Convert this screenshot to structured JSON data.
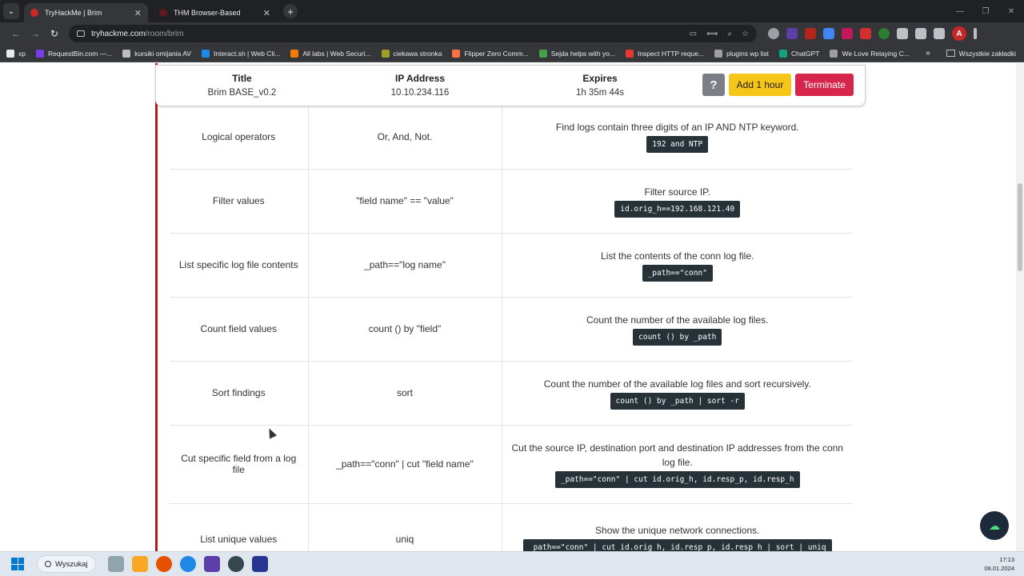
{
  "browser": {
    "tabs": [
      {
        "label": "TryHackMe | Brim",
        "active": true
      },
      {
        "label": "THM Browser-Based",
        "active": false
      }
    ],
    "url_host": "tryhackme.com",
    "url_path": "/room/brim",
    "profile_initial": "A"
  },
  "bookmarks": [
    {
      "label": "xp",
      "color": "#e8eaed"
    },
    {
      "label": "RequestBin.com —...",
      "color": "#7c3aed"
    },
    {
      "label": "kursiki omijania AV",
      "color": "#bdbdbd"
    },
    {
      "label": "Interact.sh | Web Cli...",
      "color": "#1e88e5"
    },
    {
      "label": "All labs | Web Securi...",
      "color": "#f57c00"
    },
    {
      "label": "ciekawa stronka",
      "color": "#9e9d24"
    },
    {
      "label": "Flipper Zero Comm...",
      "color": "#ff7043"
    },
    {
      "label": "Sejda helps with yo...",
      "color": "#43a047"
    },
    {
      "label": "Inspect HTTP reque...",
      "color": "#e53935"
    },
    {
      "label": "plugins wp list",
      "color": "#9e9e9e"
    },
    {
      "label": "ChatGPT",
      "color": "#10a37f"
    },
    {
      "label": "We Love Relaying C...",
      "color": "#9e9e9e"
    }
  ],
  "bookmarks_all": "Wszystkie zakładki",
  "machine": {
    "title_head": "Title",
    "title_val": "Brim BASE_v0.2",
    "ip_head": "IP Address",
    "ip_val": "10.10.234.116",
    "exp_head": "Expires",
    "exp_val": "1h 35m 44s",
    "help_label": "?",
    "add_label": "Add 1 hour",
    "terminate_label": "Terminate"
  },
  "rows": [
    {
      "purpose": "Logical operators",
      "syntax": "Or, And, Not.",
      "desc": "Find logs contain three digits of an IP AND NTP keyword.",
      "code": "192 and NTP"
    },
    {
      "purpose": "Filter values",
      "syntax": "\"field name\" == \"value\"",
      "desc": "Filter source IP.",
      "code": "id.orig_h==192.168.121.40"
    },
    {
      "purpose": "List specific log file contents",
      "syntax": "_path==\"log name\"",
      "desc": "List the contents of the conn log file.",
      "code": "_path==\"conn\""
    },
    {
      "purpose": "Count field values",
      "syntax": "count () by \"field\"",
      "desc": "Count the number of the available log files.",
      "code": "count () by _path"
    },
    {
      "purpose": "Sort findings",
      "syntax": "sort",
      "desc": "Count the number of the available log files and sort recursively.",
      "code": "count () by _path | sort -r"
    },
    {
      "purpose": "Cut specific field from a log file",
      "syntax": "_path==\"conn\" | cut \"field name\"",
      "desc": "Cut the source IP, destination port and destination IP addresses from the conn log file.",
      "code": "_path==\"conn\" | cut id.orig_h, id.resp_p, id.resp_h"
    },
    {
      "purpose": "List unique values",
      "syntax": "uniq",
      "desc": "Show the unique network connections.",
      "code": "_path==\"conn\" | cut id.orig_h, id.resp_p, id.resp_h | sort | uniq"
    }
  ],
  "taskbar": {
    "search_label": "Wyszukaj",
    "time": "17:13",
    "date": "06.01.2024"
  }
}
